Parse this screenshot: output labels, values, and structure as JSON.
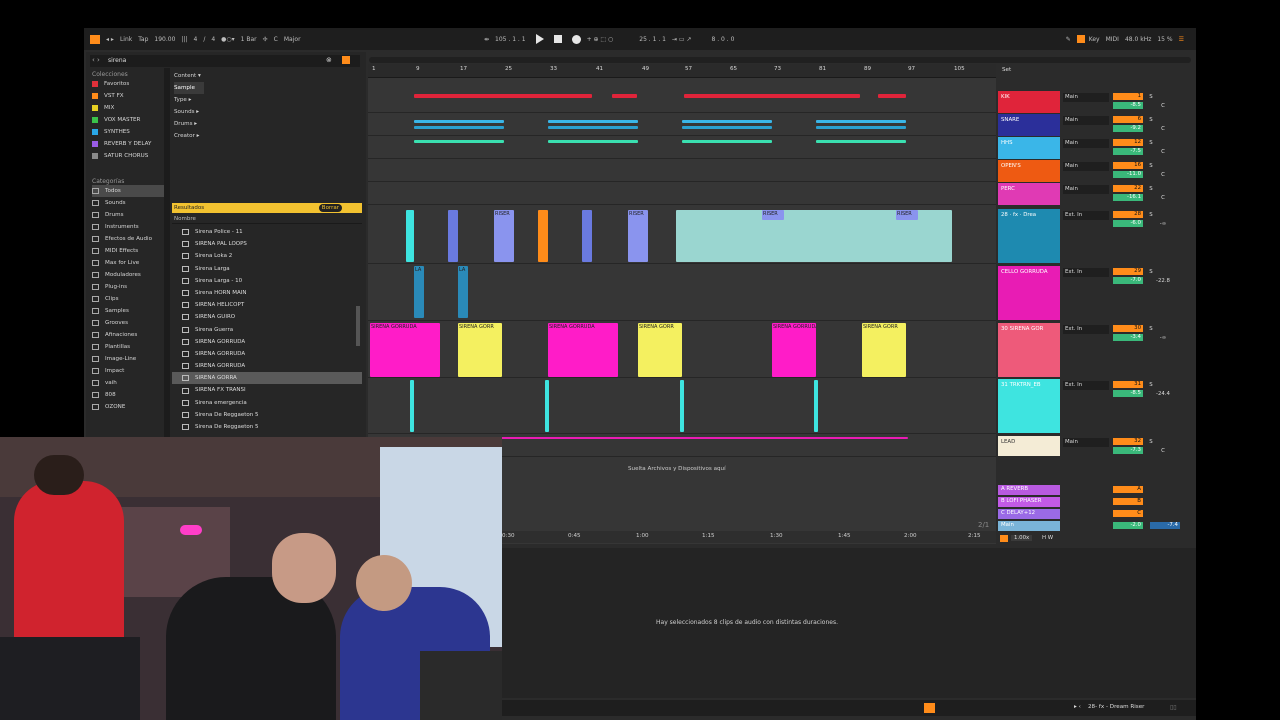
{
  "topbar": {
    "link": "Link",
    "tap": "Tap",
    "tempo": "190.00",
    "time_sig_num": "4",
    "time_sig_den": "4",
    "quantize": "1 Bar",
    "key": "C",
    "scale": "Major",
    "position": "105 .  1 .  1",
    "loop_start": "25 .  1 .  1",
    "loop_len": "8 .  0 .  0",
    "key_label": "Key",
    "midi_label": "MIDI",
    "sample_rate": "48.0 kHz",
    "cpu": "15 %"
  },
  "browser": {
    "search_value": "sirena",
    "collections_title": "Colecciones",
    "collections": [
      {
        "label": "Favoritos",
        "color": "#e0303a"
      },
      {
        "label": "VST FX",
        "color": "#ff8c1a"
      },
      {
        "label": "MIX",
        "color": "#e6d022"
      },
      {
        "label": "VOX MASTER",
        "color": "#3ac24a"
      },
      {
        "label": "SYNTHES",
        "color": "#2aa8e8"
      },
      {
        "label": "REVERB Y DELAY",
        "color": "#9a5ce6"
      },
      {
        "label": "SATUR CHORUS",
        "color": "#8a8a8a"
      }
    ],
    "categories_title": "Categorías",
    "categories": [
      "Todos",
      "Sounds",
      "Drums",
      "Instruments",
      "Efectos de Audio",
      "MIDI Effects",
      "Max for Live",
      "Moduladores",
      "Plug-ins",
      "Clips",
      "Samples",
      "Grooves",
      "Afinaciones",
      "Plantillas",
      "Image-Line",
      "Impact",
      "vaih",
      "808",
      "OZONE"
    ],
    "filters": [
      "Content ▾",
      "Sample",
      "Type ▸",
      "Sounds ▸",
      "Drums ▸",
      "Creator ▸"
    ],
    "results_label": "Resultados",
    "clear_label": "Borrar",
    "name_header": "Nombre",
    "results": [
      "Sirena Police - 11",
      "SIRENA PAL LOOPS",
      "Sirena Loka 2",
      "Sirena Larga",
      "Sirena Larga - 10",
      "Sirena HORN MAIN",
      "SIRENA HELICOPT",
      "SIRENA GUIRO",
      "Sirena Guerra",
      "SIRENA GORRUDA",
      "SIRENA GORRUDA",
      "SIRENA GORRUDA",
      "SIRENA GORRA",
      "SIRENA FX TRANSI",
      "Sirena emergencia",
      "Sirena De Reggaeton 5",
      "Sirena De Reggaeton 5"
    ]
  },
  "ruler": [
    "1",
    "9",
    "17",
    "25",
    "33",
    "41",
    "49",
    "57",
    "65",
    "73",
    "81",
    "89",
    "97",
    "105"
  ],
  "set_label": "Set",
  "clip_labels": {
    "riser": "RISER",
    "la": "LA",
    "sirena_gorr": "SIRENA GORR",
    "sirena_gorruda": "SIRENA GORRUDA"
  },
  "drop_hint": "Suelta Archivos y Dispositivos aquí",
  "time_labels": [
    "0:30",
    "0:45",
    "1:00",
    "1:15",
    "1:30",
    "1:45",
    "2:00",
    "2:15"
  ],
  "zoom_label": "2/1",
  "tracks": [
    {
      "name": "KIK",
      "color": "#e0243a",
      "route": "Main",
      "num": "1",
      "vol": "-8.5",
      "pan": "C"
    },
    {
      "name": "SNARE",
      "color": "#2b2f9a",
      "route": "Main",
      "num": "6",
      "vol": "-9.2",
      "pan": "C"
    },
    {
      "name": "HHS",
      "color": "#3ab6e8",
      "route": "Main",
      "num": "12",
      "vol": "-7.5",
      "pan": "C"
    },
    {
      "name": "OPEN'S",
      "color": "#ee5a12",
      "route": "Main",
      "num": "16",
      "vol": "-11.0",
      "pan": "C"
    },
    {
      "name": "PERC",
      "color": "#e03ab4",
      "route": "Main",
      "num": "22",
      "vol": "-16.1",
      "pan": "C"
    },
    {
      "name": "28 · fx · Drea",
      "color": "#1e8ab0",
      "route": "Ext. In",
      "num": "28",
      "vol": "-6.0",
      "pan": "-∞"
    },
    {
      "name": "CELLO GORRUDA",
      "color": "#e81cb4",
      "route": "Ext. In",
      "num": "29",
      "vol": "-7.0",
      "pan": "-22.8"
    },
    {
      "name": "30 SIRENA GOR",
      "color": "#ee5a7a",
      "route": "Ext. In",
      "num": "30",
      "vol": "-3.4",
      "pan": "-∞"
    },
    {
      "name": "31 TRKTRN_EB",
      "color": "#3ee4e0",
      "route": "Ext. In",
      "num": "31",
      "vol": "-8.5",
      "pan": "-24.4"
    },
    {
      "name": "LEAD",
      "color": "#f4ecd6",
      "route": "Main",
      "num": "32",
      "vol": "-7.3",
      "pan": "C"
    }
  ],
  "returns": [
    {
      "name": "A REVERB",
      "color": "#b85ae0",
      "num": "A"
    },
    {
      "name": "B LOFI PHASER",
      "color": "#c25ae6",
      "num": "B"
    },
    {
      "name": "C DELAY+12",
      "color": "#9a6ae6",
      "num": "C"
    },
    {
      "name": "Main",
      "color": "#7ab4d8",
      "num": "1/2"
    }
  ],
  "master_vol": "-2.0",
  "master_vol2": "-7.4",
  "master_zoom": "1.00x",
  "detail_message": "Hay seleccionados 8 clips de audio con distintas duraciones.",
  "status_track": "28- fx - Dream Riser"
}
